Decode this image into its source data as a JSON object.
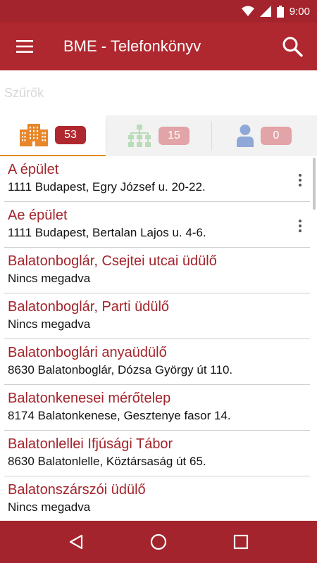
{
  "status_bar": {
    "time": "9:00"
  },
  "app_bar": {
    "title": "BME - Telefonkönyv"
  },
  "filter": {
    "placeholder": "Szűrők",
    "value": ""
  },
  "tabs": [
    {
      "icon": "buildings-icon",
      "count": "53",
      "active": true
    },
    {
      "icon": "org-chart-icon",
      "count": "15",
      "active": false
    },
    {
      "icon": "person-icon",
      "count": "0",
      "active": false
    }
  ],
  "list": {
    "items": [
      {
        "title": "A épület",
        "subtitle": "1111 Budapest, Egry József u. 20-22."
      },
      {
        "title": "Ae épület",
        "subtitle": "1111 Budapest, Bertalan Lajos u. 4-6."
      },
      {
        "title": "Balatonboglár, Csejtei utcai üdülő",
        "subtitle": "Nincs megadva"
      },
      {
        "title": "Balatonboglár, Parti üdülő",
        "subtitle": "Nincs megadva"
      },
      {
        "title": "Balatonboglári anyaüdülő",
        "subtitle": "8630 Balatonboglár, Dózsa György út 110."
      },
      {
        "title": "Balatonkenesei mérőtelep",
        "subtitle": "8174 Balatonkenese, Gesztenye fasor 14."
      },
      {
        "title": "Balatonlellei Ifjúsági Tábor",
        "subtitle": "8630 Balatonlelle, Köztársaság út 65."
      },
      {
        "title": "Balatonszárszói üdülő",
        "subtitle": "Nincs megadva"
      }
    ]
  },
  "colors": {
    "primary": "#b0282f",
    "primary_dark": "#a3242c",
    "accent": "#e08a1e",
    "badge_inactive": "#e2a4a7"
  }
}
